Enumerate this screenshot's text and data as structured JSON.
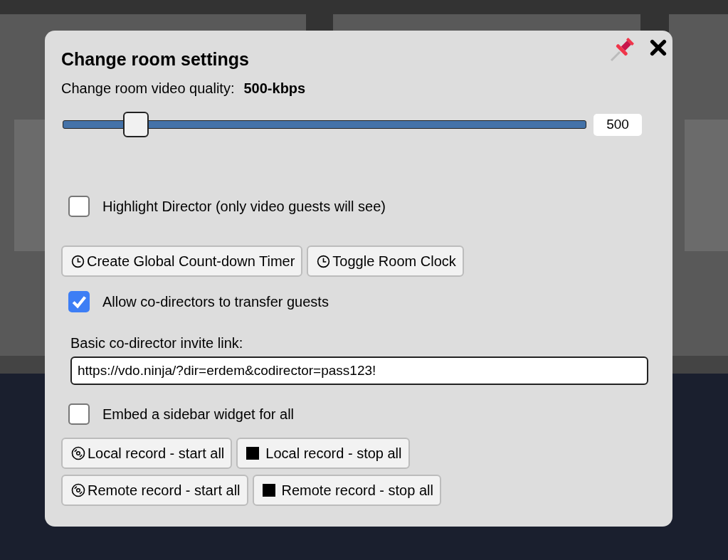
{
  "dialog": {
    "title": "Change room settings",
    "quality": {
      "label": "Change room video quality:",
      "value": "500-kbps",
      "level": 0.14,
      "reading": "500"
    },
    "highlight_director": {
      "label": "Highlight Director (only video guests will see)",
      "checked": false
    },
    "timer_buttons": [
      {
        "label": "Create Global Count-down Timer",
        "kind": "clock"
      },
      {
        "label": "Toggle Room Clock",
        "kind": "clock"
      }
    ],
    "allow_transfer": {
      "label": "Allow co-directors to transfer guests",
      "checked": true
    },
    "invite_link": {
      "label": "Basic co-director invite link:",
      "value": "https://vdo.ninja/?dir=erdem&codirector=pass123!"
    },
    "embed_widget": {
      "label": "Embed a sidebar widget for all",
      "checked": false
    },
    "record_rows": [
      [
        {
          "label": "Local record - start all",
          "kind": "start"
        },
        {
          "label": "Local record - stop all",
          "kind": "stop"
        }
      ],
      [
        {
          "label": "Remote record - start all",
          "kind": "start"
        },
        {
          "label": "Remote record - stop all",
          "kind": "stop"
        }
      ]
    ]
  }
}
